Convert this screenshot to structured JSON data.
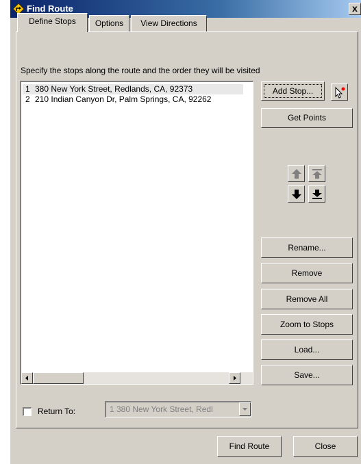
{
  "window": {
    "title": "Find Route",
    "close_glyph": "x",
    "icon": "find-route-icon"
  },
  "tabs": [
    {
      "label": "Define Stops",
      "active": true
    },
    {
      "label": "Options",
      "active": false
    },
    {
      "label": "View Directions",
      "active": false
    }
  ],
  "define_stops": {
    "instructions": "Specify the stops along the route and the order they will be visited",
    "stops": [
      {
        "num": "1",
        "address": "380 New York Street, Redlands, CA, 92373",
        "selected": true
      },
      {
        "num": "2",
        "address": "210 Indian Canyon Dr, Palm Springs, CA, 92262",
        "selected": false
      }
    ],
    "buttons": {
      "add_stop": "Add Stop...",
      "get_points": "Get Points",
      "rename": "Rename...",
      "remove": "Remove",
      "remove_all": "Remove All",
      "zoom_to_stops": "Zoom to Stops",
      "load": "Load...",
      "save": "Save..."
    },
    "order_buttons": [
      "move-up-icon",
      "move-to-top-icon",
      "move-down-icon",
      "move-to-bottom-icon"
    ],
    "return_to": {
      "label": "Return To:",
      "checked": false,
      "value": "1   380 New York Street, Redl",
      "enabled": false
    }
  },
  "footer": {
    "find_route": "Find Route",
    "close": "Close"
  },
  "colors": {
    "titlebar": "#0a246a",
    "face": "#d4d0c8",
    "marker": "#ff0000"
  }
}
